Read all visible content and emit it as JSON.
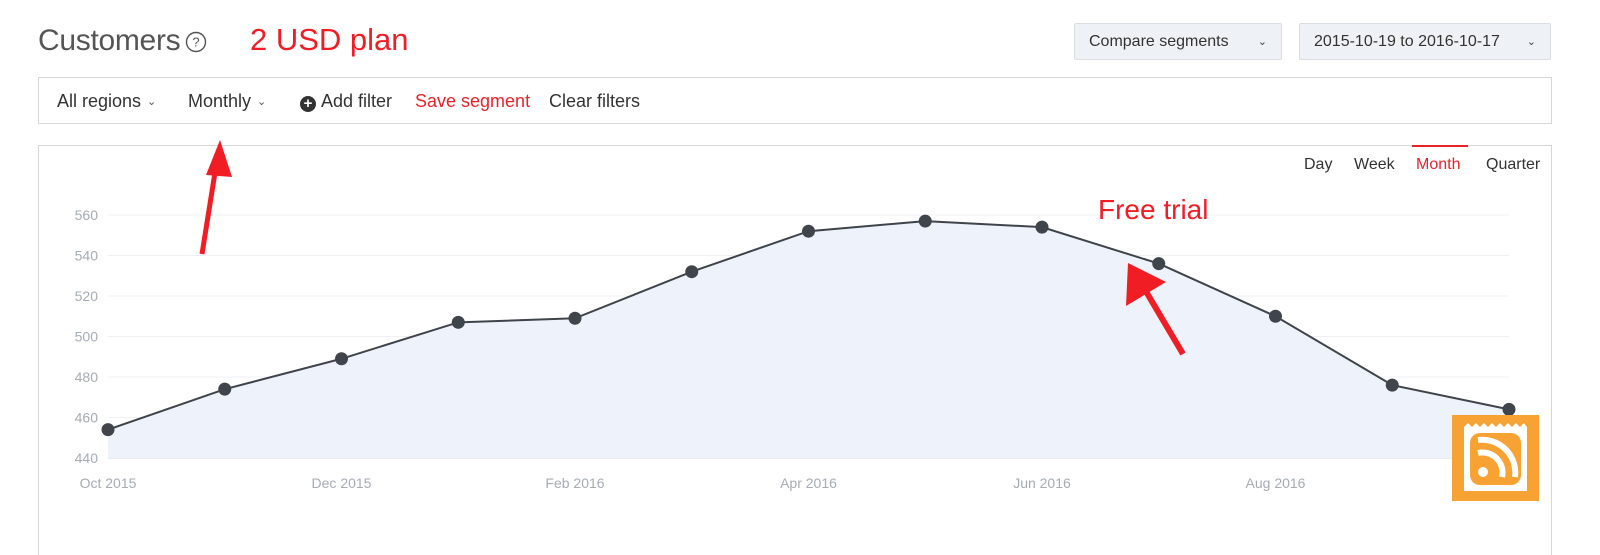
{
  "header": {
    "title": "Customers",
    "annotation": "2 USD plan",
    "compare_label": "Compare segments",
    "date_range": "2015-10-19 to 2016-10-17"
  },
  "filters": {
    "region": "All regions",
    "interval": "Monthly",
    "add_filter": "Add filter",
    "save_segment": "Save segment",
    "clear_filters": "Clear filters"
  },
  "period_tabs": [
    "Day",
    "Week",
    "Month",
    "Quarter"
  ],
  "active_period": "Month",
  "annotations": {
    "free_trial": "Free trial"
  },
  "colors": {
    "accent": "#e8232a",
    "line": "#3f444b",
    "area": "#eef3fb",
    "rss": "#f7a233"
  },
  "icons": [
    "help-icon",
    "chevron-down-icon",
    "plus-circle-icon",
    "rss-icon"
  ],
  "chart_data": {
    "type": "area",
    "x": [
      "Oct 2015",
      "Nov 2015",
      "Dec 2015",
      "Jan 2016",
      "Feb 2016",
      "Mar 2016",
      "Apr 2016",
      "May 2016",
      "Jun 2016",
      "Jul 2016",
      "Aug 2016",
      "Sep 2016",
      "Oct 2016"
    ],
    "values": [
      454,
      474,
      489,
      507,
      509,
      532,
      552,
      557,
      554,
      536,
      510,
      476,
      464
    ],
    "x_tick_labels": [
      "Oct 2015",
      "Dec 2015",
      "Feb 2016",
      "Apr 2016",
      "Jun 2016",
      "Aug 2016"
    ],
    "y_ticks": [
      440,
      460,
      480,
      500,
      520,
      540,
      560
    ],
    "ylim": [
      440,
      560
    ],
    "grid": true
  }
}
